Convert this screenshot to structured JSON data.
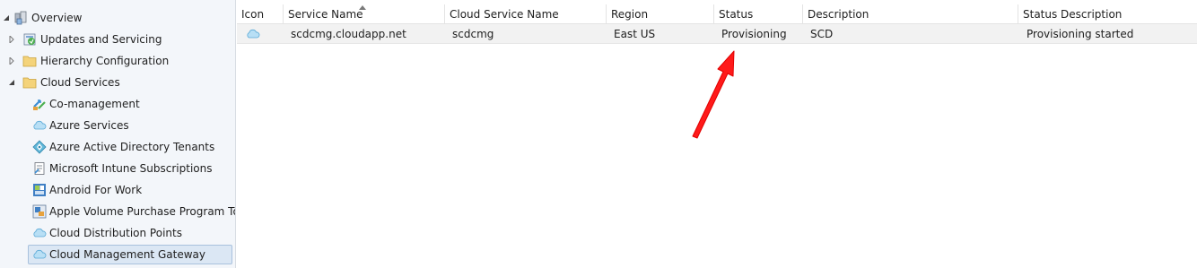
{
  "tree": {
    "items": [
      {
        "label": "Overview",
        "icon": "overview-icon",
        "expander": "expanded"
      },
      {
        "label": "Updates and Servicing",
        "icon": "updates-icon",
        "expander": "collapsed"
      },
      {
        "label": "Hierarchy Configuration",
        "icon": "folder-icon",
        "expander": "collapsed"
      },
      {
        "label": "Cloud Services",
        "icon": "folder-icon",
        "expander": "expanded"
      },
      {
        "label": "Co-management",
        "icon": "co-management-icon"
      },
      {
        "label": "Azure Services",
        "icon": "cloud-icon"
      },
      {
        "label": "Azure Active Directory Tenants",
        "icon": "azure-ad-icon"
      },
      {
        "label": "Microsoft Intune Subscriptions",
        "icon": "intune-icon"
      },
      {
        "label": "Android For Work",
        "icon": "android-work-icon"
      },
      {
        "label": "Apple Volume Purchase Program Tokens",
        "icon": "apple-vpp-icon"
      },
      {
        "label": "Cloud Distribution Points",
        "icon": "cloud-icon"
      },
      {
        "label": "Cloud Management Gateway",
        "icon": "cloud-icon",
        "selected": true
      }
    ]
  },
  "grid": {
    "columns": [
      "Icon",
      "Service Name",
      "Cloud Service Name",
      "Region",
      "Status",
      "Description",
      "Status Description"
    ],
    "sorted_column": "Service Name",
    "rows": [
      {
        "icon": "cloud-icon",
        "service_name": "scdcmg.cloudapp.net",
        "cloud_service_name": "scdcmg",
        "region": "East US",
        "status": "Provisioning",
        "description": "SCD",
        "status_description": "Provisioning started"
      }
    ]
  },
  "colors": {
    "tree_bg": "#f3f6fa",
    "selection_bg": "#dbe7f4",
    "row_bg": "#f2f2f2",
    "annotation_arrow": "#ff1a1a"
  }
}
